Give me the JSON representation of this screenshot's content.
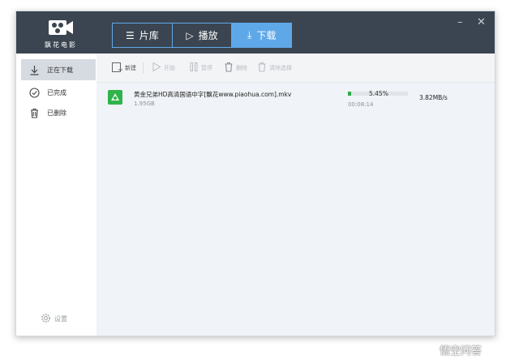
{
  "app": {
    "logo_text": "飘花电影"
  },
  "tabs": [
    {
      "label": "片库",
      "icon": "menu-icon",
      "active": false
    },
    {
      "label": "播放",
      "icon": "play-icon",
      "active": false
    },
    {
      "label": "下载",
      "icon": "download-icon",
      "active": true
    }
  ],
  "window_controls": {
    "minimize": "–",
    "close": "✕"
  },
  "sidebar": {
    "items": [
      {
        "label": "正在下载",
        "icon": "download-icon",
        "active": true
      },
      {
        "label": "已完成",
        "icon": "check-circle-icon",
        "active": false
      },
      {
        "label": "已删除",
        "icon": "trash-icon",
        "active": false
      }
    ],
    "settings_label": "设置"
  },
  "toolbar": {
    "new_label": "新建",
    "start_label": "开始",
    "pause_label": "暂停",
    "delete_label": "删除",
    "clear_label": "清除选择"
  },
  "downloads": [
    {
      "filename": "黄金兄弟HD高清国语中字[飘花www.piaohua.com].mkv",
      "size": "1.95GB",
      "percent_text": "5.45%",
      "progress": 0.0545,
      "elapsed": "00:08:14",
      "speed": "3.82MB/s"
    }
  ],
  "watermark": {
    "text": "悟空问答"
  },
  "colors": {
    "titlebar": "#3b4551",
    "accent": "#5fa8e8",
    "progress": "#2fa84a",
    "file_icon": "#2fb34a"
  }
}
